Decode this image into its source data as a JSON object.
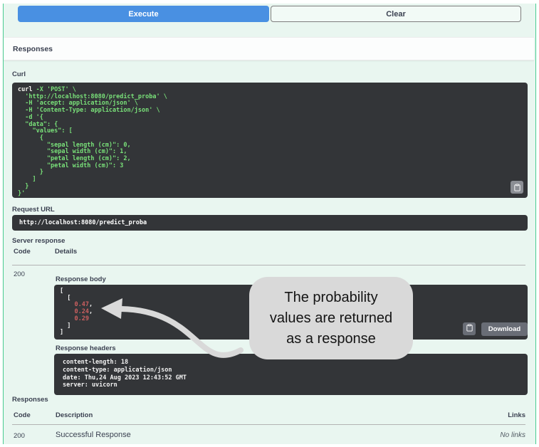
{
  "colors": {
    "accent_blue": "#4990e2",
    "opblock_green_border": "#49cc90",
    "opblock_bg": "#e9f6f0",
    "code_block_bg": "#333538",
    "code_green": "#79e079",
    "code_number_red": "#ca5f5f",
    "annotation_gray": "#d9d9d9"
  },
  "actions": {
    "execute_label": "Execute",
    "clear_label": "Clear"
  },
  "responses_header": "Responses",
  "curl": {
    "label": "Curl",
    "copy_icon": "clipboard-icon",
    "lines": [
      [
        {
          "t": "curl ",
          "c": "plain"
        },
        {
          "t": "-X 'POST' \\",
          "c": "green"
        }
      ],
      [
        {
          "t": "  'http://localhost:8080/predict_proba' \\",
          "c": "green"
        }
      ],
      [
        {
          "t": "  -H 'accept: application/json' \\",
          "c": "green"
        }
      ],
      [
        {
          "t": "  -H 'Content-Type: application/json' \\",
          "c": "green"
        }
      ],
      [
        {
          "t": "  -d '{",
          "c": "green"
        }
      ],
      [
        {
          "t": "  \"data\": {",
          "c": "green"
        }
      ],
      [
        {
          "t": "    \"values\": [",
          "c": "green"
        }
      ],
      [
        {
          "t": "      {",
          "c": "green"
        }
      ],
      [
        {
          "t": "        \"sepal length (cm)\": 0,",
          "c": "green"
        }
      ],
      [
        {
          "t": "        \"sepal width (cm)\": 1,",
          "c": "green"
        }
      ],
      [
        {
          "t": "        \"petal length (cm)\": 2,",
          "c": "green"
        }
      ],
      [
        {
          "t": "        \"petal width (cm)\": 3",
          "c": "green"
        }
      ],
      [
        {
          "t": "      }",
          "c": "green"
        }
      ],
      [
        {
          "t": "    ]",
          "c": "green"
        }
      ],
      [
        {
          "t": "  }",
          "c": "green"
        }
      ],
      [
        {
          "t": "}'",
          "c": "green"
        }
      ]
    ]
  },
  "request_url": {
    "label": "Request URL",
    "value": "http://localhost:8080/predict_proba"
  },
  "server_response": {
    "label": "Server response",
    "code_header": "Code",
    "details_header": "Details",
    "code": "200",
    "response_body": {
      "label": "Response body",
      "lines": [
        [
          {
            "t": "[",
            "c": "white"
          }
        ],
        [
          {
            "t": "  [",
            "c": "white"
          }
        ],
        [
          {
            "t": "    ",
            "c": "white"
          },
          {
            "t": "0.47",
            "c": "red"
          },
          {
            "t": ",",
            "c": "white"
          }
        ],
        [
          {
            "t": "    ",
            "c": "white"
          },
          {
            "t": "0.24",
            "c": "red"
          },
          {
            "t": ",",
            "c": "white"
          }
        ],
        [
          {
            "t": "    ",
            "c": "white"
          },
          {
            "t": "0.29",
            "c": "red"
          }
        ],
        [
          {
            "t": "  ]",
            "c": "white"
          }
        ],
        [
          {
            "t": "]",
            "c": "white"
          }
        ]
      ],
      "copy_icon": "clipboard-icon",
      "download_label": "Download"
    },
    "response_headers": {
      "label": "Response headers",
      "lines": [
        "content-length: 18",
        "content-type: application/json",
        "date: Thu,24 Aug 2023 12:43:52 GMT",
        "server: uvicorn"
      ]
    }
  },
  "annotation": {
    "line1": "The probability",
    "line2": "values are returned",
    "line3": "as a response"
  },
  "responses_table": {
    "label": "Responses",
    "code_header": "Code",
    "description_header": "Description",
    "links_header": "Links",
    "rows": [
      {
        "code": "200",
        "description": "Successful Response",
        "links": "No links"
      }
    ]
  }
}
